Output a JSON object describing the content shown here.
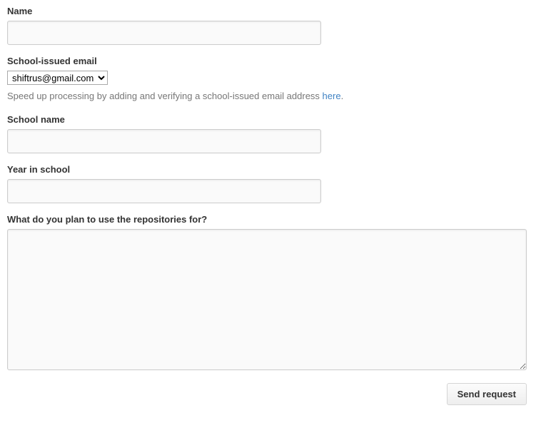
{
  "form": {
    "name": {
      "label": "Name",
      "value": ""
    },
    "email": {
      "label": "School-issued email",
      "selected": "shiftrus@gmail.com",
      "hint_prefix": "Speed up processing by adding and verifying a school-issued email address ",
      "hint_link": "here",
      "hint_suffix": "."
    },
    "school_name": {
      "label": "School name",
      "value": ""
    },
    "year": {
      "label": "Year in school",
      "value": ""
    },
    "plan": {
      "label": "What do you plan to use the repositories for?",
      "value": ""
    },
    "submit_label": "Send request"
  }
}
